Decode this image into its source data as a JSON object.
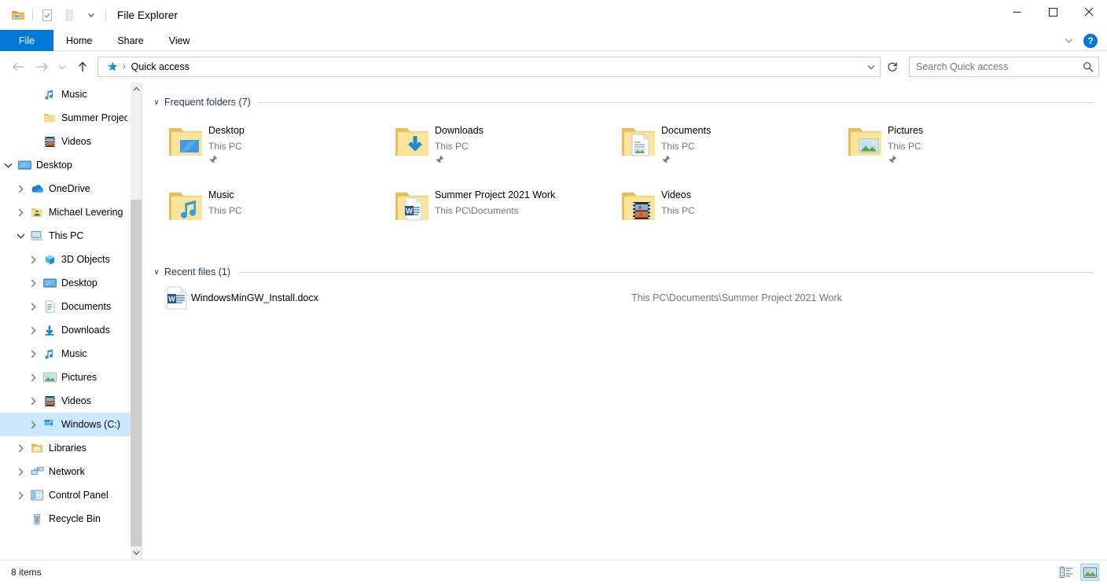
{
  "window": {
    "title": "File Explorer",
    "quick_access_toolbar": [
      {
        "name": "explorer-folder-icon",
        "label": "File Explorer"
      },
      {
        "name": "properties-icon",
        "label": "Properties"
      },
      {
        "name": "new-folder-icon",
        "label": "New folder"
      },
      {
        "name": "customize-qat-chevron-icon",
        "label": "Customize Quick Access Toolbar"
      }
    ],
    "controls": {
      "minimize": "—",
      "maximize": "□",
      "close": "✕"
    }
  },
  "ribbon": {
    "tabs": [
      {
        "label": "File",
        "active": true
      },
      {
        "label": "Home",
        "active": false
      },
      {
        "label": "Share",
        "active": false
      },
      {
        "label": "View",
        "active": false
      }
    ],
    "expand_label": "Expand the Ribbon",
    "help_label": "?"
  },
  "addressbar": {
    "back_label": "Back",
    "forward_label": "Forward",
    "recent_label": "Recent locations",
    "up_label": "Up",
    "crumb_icon": "quick-access-star-icon",
    "crumb": "Quick access",
    "crumb_separator": "›",
    "dropdown_label": "Previous locations",
    "refresh_label": "Refresh"
  },
  "search": {
    "placeholder": "Search Quick access",
    "value": ""
  },
  "navpane": {
    "items": [
      {
        "label": "Music",
        "icon": "music-note-icon",
        "indent": 2,
        "chevron": "none",
        "selected": false
      },
      {
        "label": "Summer Project",
        "icon": "folder-icon",
        "indent": 2,
        "chevron": "none",
        "selected": false
      },
      {
        "label": "Videos",
        "icon": "videos-film-icon",
        "indent": 2,
        "chevron": "none",
        "selected": false
      },
      {
        "label": "Desktop",
        "icon": "desktop-monitor-icon",
        "indent": 0,
        "chevron": "open",
        "selected": false
      },
      {
        "label": "OneDrive",
        "icon": "onedrive-cloud-icon",
        "indent": 1,
        "chevron": "closed",
        "selected": false
      },
      {
        "label": "Michael Levering",
        "icon": "user-folder-icon",
        "indent": 1,
        "chevron": "closed",
        "selected": false
      },
      {
        "label": "This PC",
        "icon": "this-pc-icon",
        "indent": 1,
        "chevron": "open",
        "selected": false
      },
      {
        "label": "3D Objects",
        "icon": "3d-objects-icon",
        "indent": 2,
        "chevron": "closed",
        "selected": false
      },
      {
        "label": "Desktop",
        "icon": "desktop-monitor-icon",
        "indent": 2,
        "chevron": "closed",
        "selected": false
      },
      {
        "label": "Documents",
        "icon": "documents-icon",
        "indent": 2,
        "chevron": "closed",
        "selected": false
      },
      {
        "label": "Downloads",
        "icon": "downloads-arrow-icon",
        "indent": 2,
        "chevron": "closed",
        "selected": false
      },
      {
        "label": "Music",
        "icon": "music-note-icon",
        "indent": 2,
        "chevron": "closed",
        "selected": false
      },
      {
        "label": "Pictures",
        "icon": "pictures-icon",
        "indent": 2,
        "chevron": "closed",
        "selected": false
      },
      {
        "label": "Videos",
        "icon": "videos-film-icon",
        "indent": 2,
        "chevron": "closed",
        "selected": false
      },
      {
        "label": "Windows (C:)",
        "icon": "local-disk-icon",
        "indent": 2,
        "chevron": "closed",
        "selected": true
      },
      {
        "label": "Libraries",
        "icon": "libraries-icon",
        "indent": 1,
        "chevron": "closed",
        "selected": false
      },
      {
        "label": "Network",
        "icon": "network-icon",
        "indent": 1,
        "chevron": "closed",
        "selected": false
      },
      {
        "label": "Control Panel",
        "icon": "control-panel-icon",
        "indent": 1,
        "chevron": "closed",
        "selected": false
      },
      {
        "label": "Recycle Bin",
        "icon": "recycle-bin-icon",
        "indent": 1,
        "chevron": "none",
        "selected": false
      }
    ]
  },
  "content": {
    "frequent": {
      "title": "Frequent folders (7)",
      "collapse_glyph": "∨",
      "items": [
        {
          "name": "Desktop",
          "sub": "This PC",
          "icon": "folder-desktop-icon",
          "pinned": true
        },
        {
          "name": "Downloads",
          "sub": "This PC",
          "icon": "folder-downloads-icon",
          "pinned": true
        },
        {
          "name": "Documents",
          "sub": "This PC",
          "icon": "folder-documents-icon",
          "pinned": true
        },
        {
          "name": "Pictures",
          "sub": "This PC",
          "icon": "folder-pictures-icon",
          "pinned": true
        },
        {
          "name": "Music",
          "sub": "This PC",
          "icon": "folder-music-icon",
          "pinned": false
        },
        {
          "name": "Summer Project 2021 Work",
          "sub": "This PC\\Documents",
          "icon": "folder-word-doc-icon",
          "pinned": false
        },
        {
          "name": "Videos",
          "sub": "This PC",
          "icon": "folder-videos-icon",
          "pinned": false
        }
      ]
    },
    "recent": {
      "title": "Recent files (1)",
      "collapse_glyph": "∨",
      "items": [
        {
          "name": "WindowsMinGW_Install.docx",
          "path": "This PC\\Documents\\Summer Project 2021 Work",
          "icon": "word-document-icon"
        }
      ]
    }
  },
  "statusbar": {
    "items_text": "8 items",
    "details_view_label": "Details view",
    "large_icons_view_label": "Large icons view",
    "selected_view": "large-icons"
  },
  "colors": {
    "accent": "#0078d7",
    "selection": "#cce8ff",
    "group_title": "#1f3864",
    "folder": "#ffd966",
    "muted_text": "#757575"
  }
}
